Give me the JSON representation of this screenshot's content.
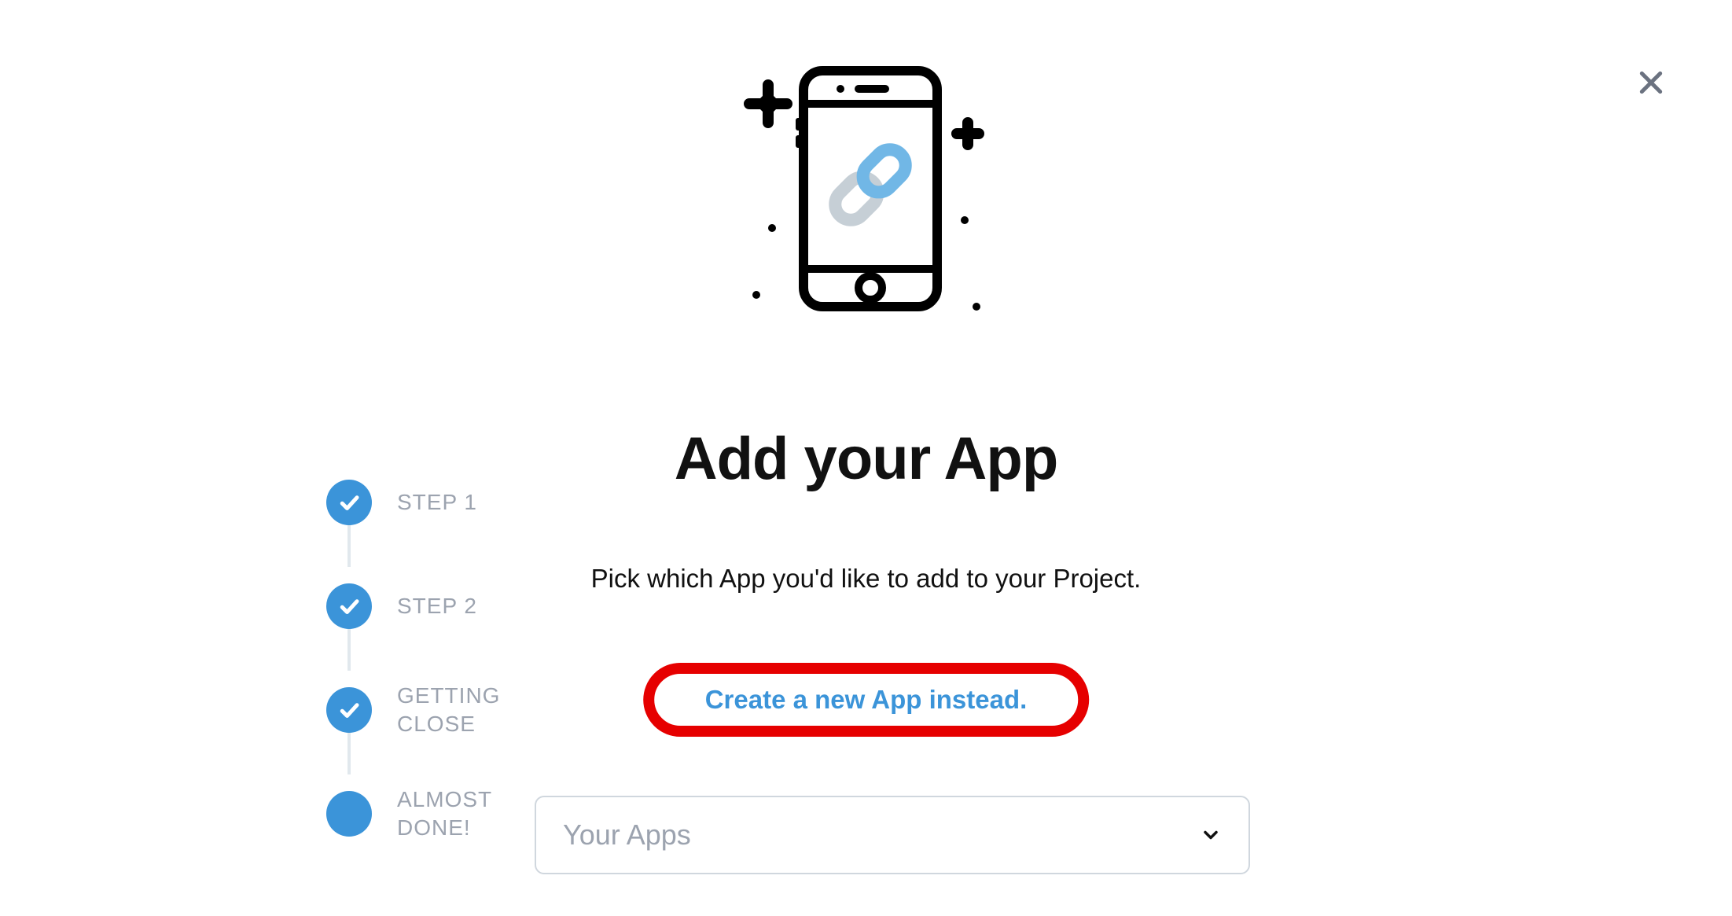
{
  "close": {
    "label": "Close"
  },
  "stepper": {
    "items": [
      {
        "label": "STEP 1",
        "done": true
      },
      {
        "label": "STEP 2",
        "done": true
      },
      {
        "label": "GETTING CLOSE",
        "done": true
      },
      {
        "label": "ALMOST DONE!",
        "done": false
      }
    ]
  },
  "main": {
    "title": "Add your App",
    "subtitle": "Pick which App you'd like to add to your Project.",
    "cta": "Create a new App instead."
  },
  "select": {
    "placeholder": "Your Apps"
  },
  "colors": {
    "accent": "#3b94d9",
    "highlight": "#e60000",
    "muted": "#9ca3af"
  }
}
